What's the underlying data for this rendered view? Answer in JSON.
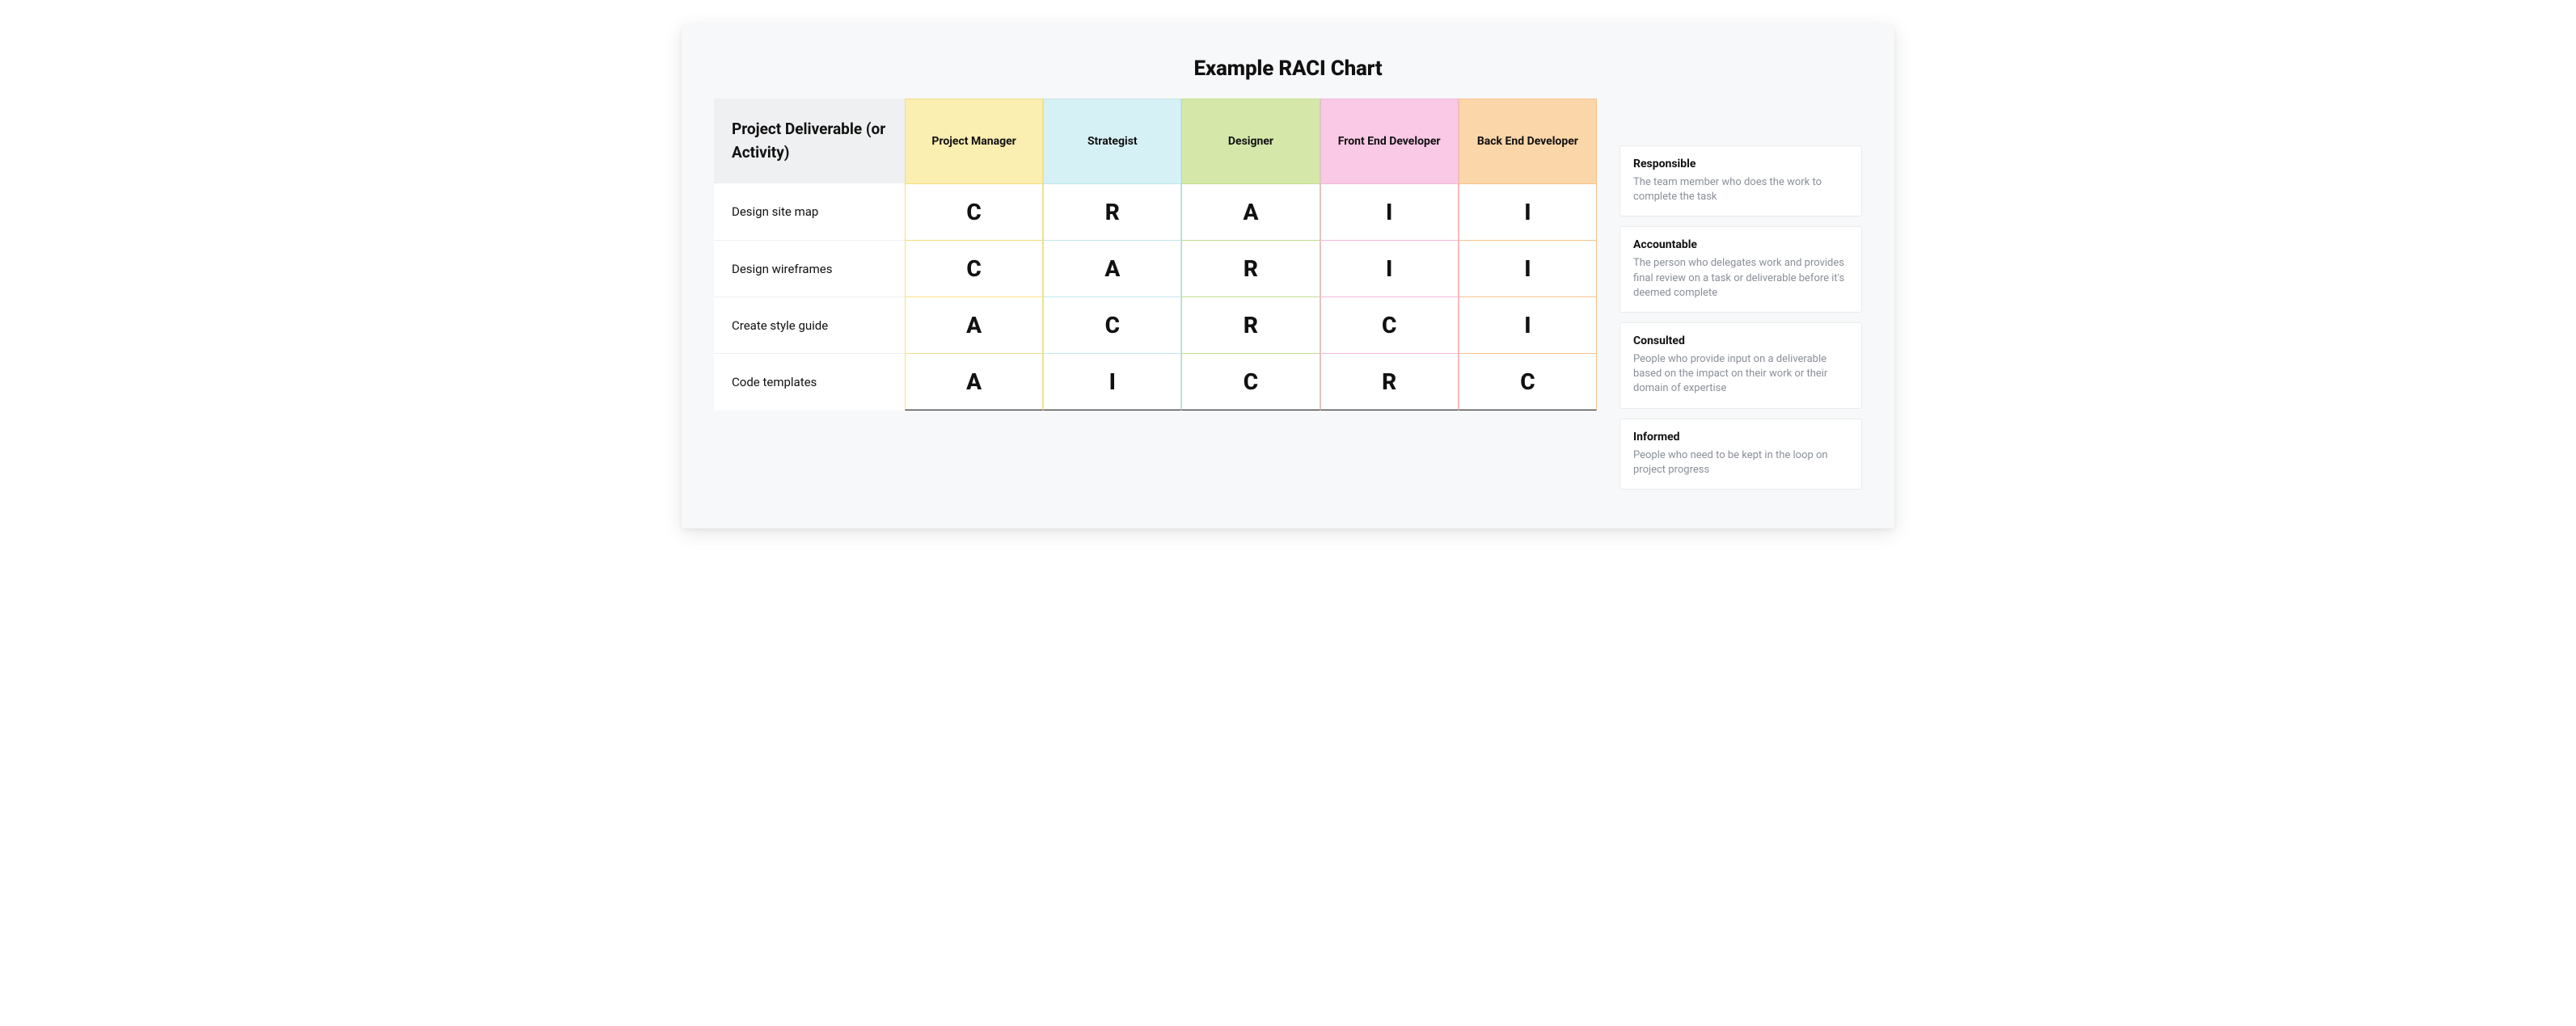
{
  "title": "Example RACI Chart",
  "deliverable_header": "Project Deliverable (or Activity)",
  "roles": [
    {
      "label": "Project Manager"
    },
    {
      "label": "Strategist"
    },
    {
      "label": "Designer"
    },
    {
      "label": "Front End Developer"
    },
    {
      "label": "Back End Developer"
    }
  ],
  "rows": [
    {
      "label": "Design site map",
      "values": [
        "C",
        "R",
        "A",
        "I",
        "I"
      ]
    },
    {
      "label": "Design wireframes",
      "values": [
        "C",
        "A",
        "R",
        "I",
        "I"
      ]
    },
    {
      "label": "Create style guide",
      "values": [
        "A",
        "C",
        "R",
        "C",
        "I"
      ]
    },
    {
      "label": "Code templates",
      "values": [
        "A",
        "I",
        "C",
        "R",
        "C"
      ]
    }
  ],
  "legend": [
    {
      "term": "Responsible",
      "desc": "The team member who does the work to complete the task"
    },
    {
      "term": "Accountable",
      "desc": "The person who delegates work and provides final review on a task or deliverable before it's deemed complete"
    },
    {
      "term": "Consulted",
      "desc": "People who provide input on a deliverable based on the impact on their work or their domain of expertise"
    },
    {
      "term": "Informed",
      "desc": "People who need to be kept in the loop on project progress"
    }
  ],
  "chart_data": {
    "type": "table",
    "title": "Example RACI Chart",
    "columns": [
      "Project Manager",
      "Strategist",
      "Designer",
      "Front End Developer",
      "Back End Developer"
    ],
    "rows": [
      "Design site map",
      "Design wireframes",
      "Create style guide",
      "Code templates"
    ],
    "values": [
      [
        "C",
        "R",
        "A",
        "I",
        "I"
      ],
      [
        "C",
        "A",
        "R",
        "I",
        "I"
      ],
      [
        "A",
        "C",
        "R",
        "C",
        "I"
      ],
      [
        "A",
        "I",
        "C",
        "R",
        "C"
      ]
    ],
    "legend": {
      "R": "Responsible",
      "A": "Accountable",
      "C": "Consulted",
      "I": "Informed"
    }
  }
}
